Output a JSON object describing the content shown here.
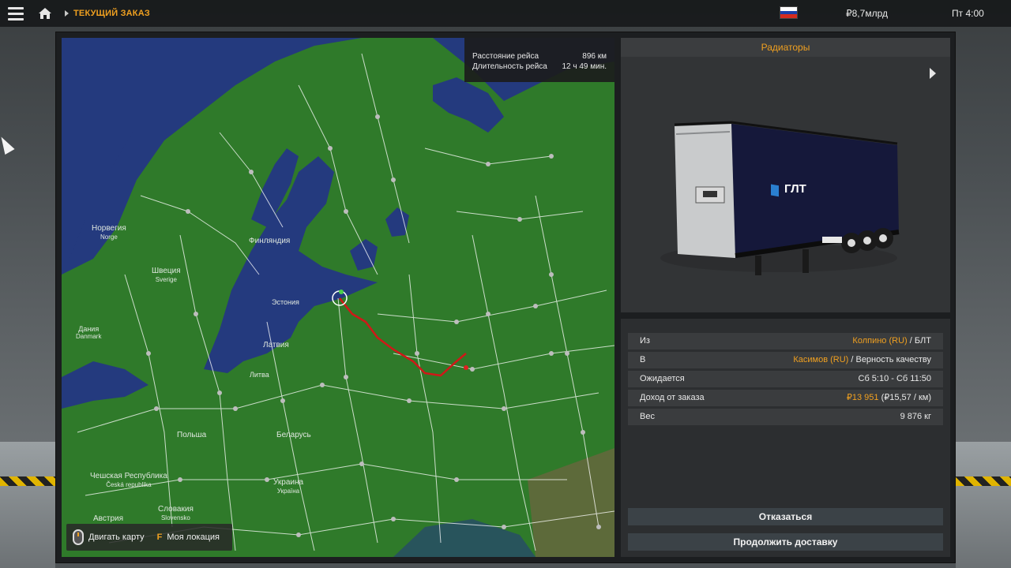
{
  "topbar": {
    "breadcrumb": "ТЕКУЩИЙ ЗАКАЗ",
    "money": "₽8,7млрд",
    "clock": "Пт 4:00",
    "menu_icon": "hamburger-icon",
    "home_icon": "home-icon",
    "flag_colors": [
      "#ffffff",
      "#1c3fa8",
      "#d52b1e"
    ]
  },
  "trip": {
    "distance_label": "Расстояние рейса",
    "distance_value": "896 км",
    "duration_label": "Длительность рейса",
    "duration_value": "12 ч 49 мин."
  },
  "map": {
    "labels": {
      "norway": "Норвегия",
      "norway_en": "Norge",
      "finland": "Финляндия",
      "sweden": "Швеция",
      "sweden_en": "Sverige",
      "latvia": "Латвия",
      "belarus": "Беларусь",
      "poland": "Польша",
      "czech": "Чешская Республика",
      "czech_en": "Česká republika",
      "slovakia": "Словакия",
      "slovakia_en": "Slovensko",
      "austria": "Австрия",
      "ukraine": "Украина",
      "ukraine_en": "Україна",
      "denmark": "Дания",
      "denmark_en": "Danmark",
      "estonia": "Эстония",
      "lithuania": "Литва"
    },
    "hint_move": "Двигать карту",
    "hint_key": "F",
    "hint_location": "Моя локация"
  },
  "cargo": {
    "title": "Радиаторы",
    "brand": "ГЛТ"
  },
  "job": {
    "from_label": "Из",
    "from_city": "Колпино (RU)",
    "from_company": " / БЛТ",
    "to_label": "В",
    "to_city": "Касимов (RU)",
    "to_company": " / Верность качеству",
    "expected_label": "Ожидается",
    "expected_value": "Сб 5:10 - Сб 11:50",
    "income_label": "Доход от заказа",
    "income_value": "₽13 951",
    "income_rate": " (₽15,57 / км)",
    "weight_label": "Вес",
    "weight_value": "9 876 кг"
  },
  "actions": {
    "decline": "Отказаться",
    "continue": "Продолжить доставку"
  },
  "colors": {
    "accent": "#f0a020",
    "land": "#2f7a2a",
    "water": "#243a7e",
    "route": "#d01818"
  }
}
